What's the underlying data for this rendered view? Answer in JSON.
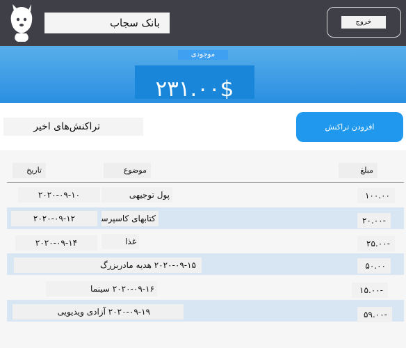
{
  "header": {
    "bank_name": "بانک سجاب",
    "logout_label": "خروج"
  },
  "balance": {
    "label": "موجودی",
    "value": "۲۳۱.۰۰$"
  },
  "transactions": {
    "title": "تراکنش‌های اخیر",
    "add_button_label": "افزودن تراکنش",
    "columns": {
      "date": "تاریخ",
      "description": "موضوع",
      "amount": "مبلغ"
    },
    "rows": [
      {
        "date": "۲۰۲۰-۰۹-۱۰",
        "description": "پول توجیهی",
        "amount": "۱۰۰.۰۰"
      },
      {
        "date": "۲۰۲۰-۰۹-۱۲",
        "description": "کتابهای کاسپرسکی",
        "amount": "-۲۰.۰۰"
      },
      {
        "date": "۲۰۲۰-۰۹-۱۴",
        "description": "غذا",
        "amount": "-۲۵.۰۰"
      },
      {
        "date": "۲۰۲۰-۰۹-۱۵",
        "description": "۲۰۲۰-۰۹-۱۵ هدیه مادربزرگ",
        "amount": "۵۰.۰۰"
      },
      {
        "date": "۲۰۲۰-۰۹-۱۶",
        "description": "۲۰۲۰-۰۹-۱۶ سینما",
        "amount": "-۱۵.۰۰"
      },
      {
        "date": "۲۰۲۰-۰۹-۱۹",
        "description": "۲۰۲۰-۰۹-۱۹ آزادی ویدیویی",
        "amount": "-۵۹.۰۰"
      }
    ]
  },
  "colors": {
    "topbar": "#3f3f47",
    "accent": "#1f98ee",
    "row_alt": "#d8e6f3"
  }
}
